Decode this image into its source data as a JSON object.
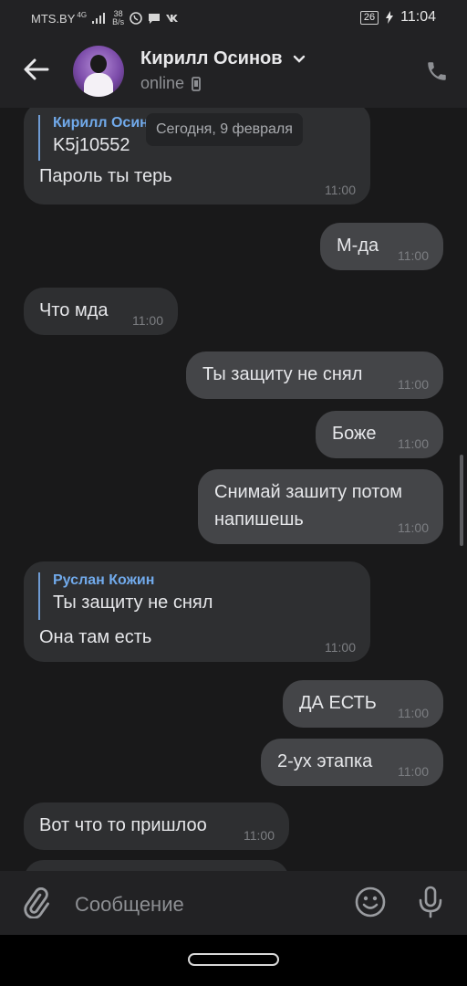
{
  "status_bar": {
    "carrier": "MTS.BY",
    "network": "4G",
    "speed_value": "38",
    "speed_unit": "B/s",
    "battery": "26",
    "time": "11:04"
  },
  "header": {
    "contact_name": "Кирилл Осинов",
    "status": "online"
  },
  "chat": {
    "date_divider": "Сегодня, 9 февраля",
    "messages": [
      {
        "direction": "in",
        "reply_name": "Кирилл Осин",
        "reply_text": "K5j10552",
        "text": "Пароль ты терь",
        "time": "11:00"
      },
      {
        "direction": "out",
        "text": "М-да",
        "time": "11:00"
      },
      {
        "direction": "in",
        "text": "Что мда",
        "time": "11:00"
      },
      {
        "direction": "out",
        "text": "Ты защиту не снял",
        "time": "11:00"
      },
      {
        "direction": "out",
        "text": "Боже",
        "time": "11:00"
      },
      {
        "direction": "out",
        "text_line1": "Снимай зашиту потом",
        "text_line2": "напишешь",
        "time": "11:00"
      },
      {
        "direction": "in",
        "reply_name": "Руслан Кожин",
        "reply_text": "Ты защиту не снял",
        "text": "Она там есть",
        "time": "11:00"
      },
      {
        "direction": "out",
        "text": "ДА ЕСТЬ",
        "time": "11:00"
      },
      {
        "direction": "out",
        "text": "2-ух этапка",
        "time": "11:00"
      },
      {
        "direction": "in",
        "text": "Вот что то пришлоо",
        "time": "11:00"
      }
    ]
  },
  "input_bar": {
    "placeholder": "Сообщение"
  },
  "icons": {
    "back": "back-arrow-icon",
    "dropdown": "chevron-down-icon",
    "device": "mobile-device-icon",
    "call": "phone-icon",
    "attach": "paperclip-icon",
    "emoji": "emoji-icon",
    "voice": "microphone-icon"
  },
  "colors": {
    "background": "#19191a",
    "bar": "#222224",
    "incoming_bubble": "#2e2f31",
    "outgoing_bubble": "#444548",
    "reply_accent": "#71aaeb"
  }
}
